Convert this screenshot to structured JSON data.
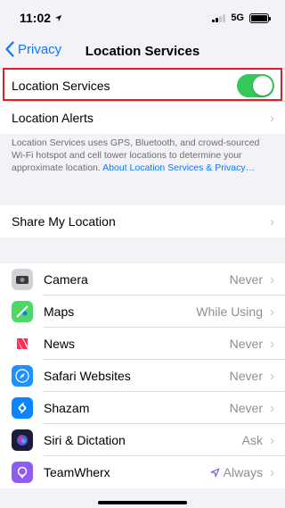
{
  "status": {
    "time": "11:02",
    "network": "5G"
  },
  "nav": {
    "back_label": "Privacy",
    "title": "Location Services"
  },
  "location_services": {
    "label": "Location Services",
    "enabled": true
  },
  "location_alerts": {
    "label": "Location Alerts"
  },
  "footer": {
    "text": "Location Services uses GPS, Bluetooth, and crowd-sourced Wi-Fi hotspot and cell tower locations to determine your approximate location.",
    "link": "About Location Services & Privacy…"
  },
  "share_my_location": {
    "label": "Share My Location"
  },
  "apps": [
    {
      "name": "Camera",
      "value": "Never",
      "icon": "camera-icon",
      "color": "#d1d1d6"
    },
    {
      "name": "Maps",
      "value": "While Using",
      "icon": "maps-icon",
      "color": "#4cd964"
    },
    {
      "name": "News",
      "value": "Never",
      "icon": "news-icon",
      "color": "#ff3b5c"
    },
    {
      "name": "Safari Websites",
      "value": "Never",
      "icon": "safari-icon",
      "color": "#1e90ff"
    },
    {
      "name": "Shazam",
      "value": "Never",
      "icon": "shazam-icon",
      "color": "#0a84ff"
    },
    {
      "name": "Siri & Dictation",
      "value": "Ask",
      "icon": "siri-icon",
      "color": "#2b2b6e"
    },
    {
      "name": "TeamWherx",
      "value": "Always",
      "icon": "teamwherx-icon",
      "color": "#8e5cf0",
      "location_arrow": true
    }
  ],
  "colors": {
    "accent": "#0a7aff",
    "toggle_on": "#34c759",
    "highlight": "#e01e25"
  }
}
